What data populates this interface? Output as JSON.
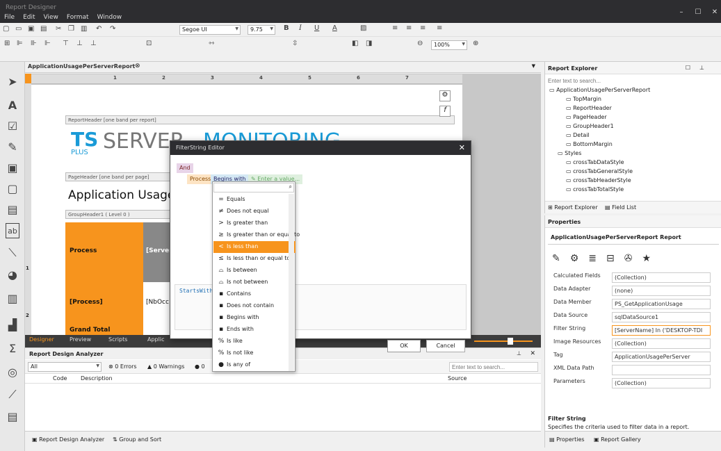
{
  "app": {
    "title": "Report Designer",
    "minimize": "–",
    "maximize": "☐",
    "close": "✕"
  },
  "menu": [
    "File",
    "Edit",
    "View",
    "Format",
    "Window"
  ],
  "toolbar": {
    "font": "Segoe UI",
    "size": "9.75",
    "zoom": "100%"
  },
  "document": {
    "tab": "ApplicationUsagePerServerReport"
  },
  "ruler": [
    "1",
    "2",
    "3",
    "4",
    "5",
    "6",
    "7"
  ],
  "bands": {
    "report_header": "ReportHeader [one band per report]",
    "page_header": "PageHeader [one band per page]",
    "group_header": "GroupHeader1 ( Level 0 )"
  },
  "canvas": {
    "logo_ts": "TS",
    "logo_plus": "PLUS",
    "logo_server": "SERVER",
    "logo_monitoring": "MONITORING",
    "title": "Application Usage p",
    "cell_process": "Process",
    "cell_server": "[Server",
    "cell_process_field": "[Process]",
    "cell_nbocc": "[NbOcc",
    "grand_total": "Grand Total",
    "row1": "1",
    "row2": "2"
  },
  "bottom_tabs": [
    "Designer",
    "Preview",
    "Scripts",
    "Applic"
  ],
  "analyzer": {
    "title": "Report Design Analyzer",
    "filter": "All",
    "errors": "0 Errors",
    "warnings": "0 Warnings",
    "info": "0",
    "search_placeholder": "Enter text to search...",
    "col_code": "Code",
    "col_description": "Description",
    "col_source": "Source",
    "foot_analyzer": "Report Design Analyzer",
    "foot_group": "Group and Sort"
  },
  "explorer": {
    "title": "Report Explorer",
    "search_placeholder": "Enter text to search...",
    "items": [
      {
        "label": "ApplicationUsagePerServerReport",
        "level": 0
      },
      {
        "label": "TopMargin",
        "level": 2
      },
      {
        "label": "ReportHeader",
        "level": 2
      },
      {
        "label": "PageHeader",
        "level": 2
      },
      {
        "label": "GroupHeader1",
        "level": 2
      },
      {
        "label": "Detail",
        "level": 2
      },
      {
        "label": "BottomMargin",
        "level": 2
      },
      {
        "label": "Styles",
        "level": 1
      },
      {
        "label": "crossTabDataStyle",
        "level": 2
      },
      {
        "label": "crossTabGeneralStyle",
        "level": 2
      },
      {
        "label": "crossTabHeaderStyle",
        "level": 2
      },
      {
        "label": "crossTabTotalStyle",
        "level": 2
      }
    ],
    "tab_explorer": "Report Explorer",
    "tab_fieldlist": "Field List"
  },
  "properties": {
    "title": "Properties",
    "object": "ApplicationUsagePerServerReport",
    "object_type": "Report",
    "rows": [
      {
        "name": "Calculated Fields",
        "value": "(Collection)"
      },
      {
        "name": "Data Adapter",
        "value": "(none)"
      },
      {
        "name": "Data Member",
        "value": "PS_GetApplicationUsage"
      },
      {
        "name": "Data Source",
        "value": "sqlDataSource1"
      },
      {
        "name": "Filter String",
        "value": "[ServerName] In ('DESKTOP-TDI"
      },
      {
        "name": "Image Resources",
        "value": "(Collection)"
      },
      {
        "name": "Tag",
        "value": "ApplicationUsagePerServer"
      },
      {
        "name": "XML Data Path",
        "value": ""
      },
      {
        "name": "Parameters",
        "value": "(Collection)"
      }
    ],
    "desc_title": "Filter String",
    "desc_text": "Specifies the criteria used to filter data in a report.",
    "tab_properties": "Properties",
    "tab_gallery": "Report Gallery"
  },
  "dialog": {
    "title": "FilterString Editor",
    "group": "And",
    "field": "Process",
    "operator": "Begins with",
    "value_placeholder": "Enter a value...",
    "expression": "StartsWith",
    "ok": "OK",
    "cancel": "Cancel"
  },
  "operators": [
    {
      "icon": "=",
      "label": "Equals"
    },
    {
      "icon": "≠",
      "label": "Does not equal"
    },
    {
      "icon": ">",
      "label": "Is greater than"
    },
    {
      "icon": "≥",
      "label": "Is greater than or equal to"
    },
    {
      "icon": "<",
      "label": "Is less than"
    },
    {
      "icon": "≤",
      "label": "Is less than or equal to"
    },
    {
      "icon": "⌓",
      "label": "Is between"
    },
    {
      "icon": "⌓",
      "label": "Is not between"
    },
    {
      "icon": "▪",
      "label": "Contains"
    },
    {
      "icon": "▪",
      "label": "Does not contain"
    },
    {
      "icon": "▪",
      "label": "Begins with"
    },
    {
      "icon": "▪",
      "label": "Ends with"
    },
    {
      "icon": "%",
      "label": "Is like"
    },
    {
      "icon": "%",
      "label": "Is not like"
    },
    {
      "icon": "●",
      "label": "Is any of"
    }
  ],
  "selected_operator": 4,
  "colors": {
    "accent": "#f7941d",
    "title_bg": "#2d2d30",
    "logo_blue": "#1a9bd7"
  }
}
